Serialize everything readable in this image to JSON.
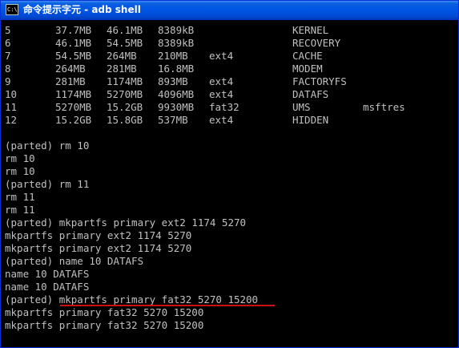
{
  "window": {
    "icon_text": "C:\\",
    "title": "命令提示字元 - adb shell"
  },
  "partition_table": [
    {
      "num": "5",
      "start": "37.7MB",
      "end": "46.1MB",
      "size": "8389kB",
      "fs": "",
      "name": "KERNEL",
      "flags": ""
    },
    {
      "num": "6",
      "start": "46.1MB",
      "end": "54.5MB",
      "size": "8389kB",
      "fs": "",
      "name": "RECOVERY",
      "flags": ""
    },
    {
      "num": "7",
      "start": "54.5MB",
      "end": "264MB",
      "size": "210MB",
      "fs": "ext4",
      "name": "CACHE",
      "flags": ""
    },
    {
      "num": "8",
      "start": "264MB",
      "end": "281MB",
      "size": "16.8MB",
      "fs": "",
      "name": "MODEM",
      "flags": ""
    },
    {
      "num": "9",
      "start": "281MB",
      "end": "1174MB",
      "size": "893MB",
      "fs": "ext4",
      "name": "FACTORYFS",
      "flags": ""
    },
    {
      "num": "10",
      "start": "1174MB",
      "end": "5270MB",
      "size": "4096MB",
      "fs": "ext4",
      "name": "DATAFS",
      "flags": ""
    },
    {
      "num": "11",
      "start": "5270MB",
      "end": "15.2GB",
      "size": "9930MB",
      "fs": "fat32",
      "name": "UMS",
      "flags": "msftres"
    },
    {
      "num": "12",
      "start": "15.2GB",
      "end": "15.8GB",
      "size": "537MB",
      "fs": "ext4",
      "name": "HIDDEN",
      "flags": ""
    }
  ],
  "session_lines": [
    "(parted) rm 10",
    "rm 10",
    "rm 10",
    "(parted) rm 11",
    "rm 11",
    "rm 11",
    "(parted) mkpartfs primary ext2 1174 5270",
    "mkpartfs primary ext2 1174 5270",
    "mkpartfs primary ext2 1174 5270",
    "(parted) name 10 DATAFS",
    "name 10 DATAFS",
    "name 10 DATAFS",
    "(parted) mkpartfs primary fat32 5270 15200",
    "mkpartfs primary fat32 5270 15200",
    "mkpartfs primary fat32 5270 15200"
  ],
  "colors": {
    "console_background": "#000000",
    "console_text": "#c0c0c0",
    "highlight_underline": "#cc1010",
    "titlebar": "#0055e5"
  }
}
